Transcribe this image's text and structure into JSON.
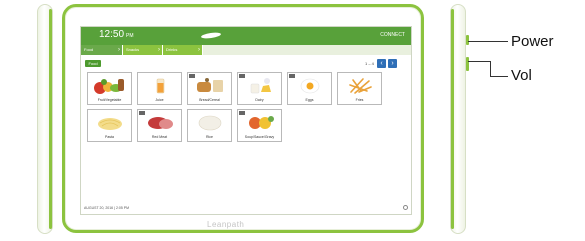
{
  "callouts": {
    "power": "Power",
    "vol": "Vol"
  },
  "device": {
    "brand": "Leanpath"
  },
  "header": {
    "time": "12:50",
    "ampm": "PM",
    "connect": "CONNECT"
  },
  "tabs": [
    {
      "label": "Food"
    },
    {
      "label": "Snacks"
    },
    {
      "label": "Drinks"
    }
  ],
  "toolbar": {
    "food_button": "Food",
    "page_indicator": "1 – 4",
    "prev": "‹",
    "next": "›"
  },
  "tiles": [
    {
      "label": "Fruit/Vegetable",
      "icon": "fruit-vegetable-image"
    },
    {
      "label": "Juice",
      "icon": "juice-image"
    },
    {
      "label": "Bread/Cereal",
      "icon": "bread-cereal-image"
    },
    {
      "label": "Dairy",
      "icon": "dairy-image"
    },
    {
      "label": "Eggs",
      "icon": "eggs-image"
    },
    {
      "label": "Fries",
      "icon": "fries-image"
    },
    {
      "label": "Pasta",
      "icon": "pasta-image"
    },
    {
      "label": "Red Meat",
      "icon": "red-meat-image"
    },
    {
      "label": "Rice",
      "icon": "rice-image"
    },
    {
      "label": "Soup/Sauce/Gravy",
      "icon": "soup-sauce-gravy-image"
    }
  ],
  "footer": {
    "datetime": "AUGUST 20, 2016  |  2:05 PM"
  },
  "colors": {
    "accent_green": "#8cc33f",
    "header_green": "#58a13a",
    "nav_blue": "#2f6fb7"
  }
}
